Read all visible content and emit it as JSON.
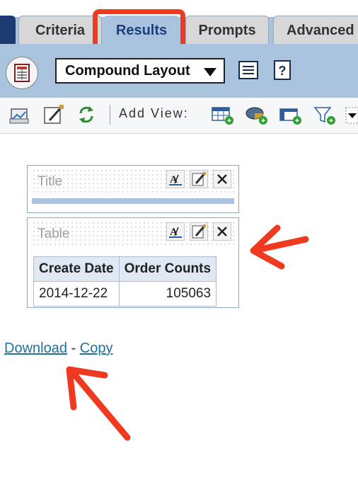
{
  "tabs": [
    {
      "label": "Criteria",
      "active": false
    },
    {
      "label": "Results",
      "active": true
    },
    {
      "label": "Prompts",
      "active": false
    },
    {
      "label": "Advanced",
      "active": false
    }
  ],
  "toolbar": {
    "layout_select": "Compound Layout",
    "add_view_label": "Add View:"
  },
  "title_view": {
    "header_label": "Title"
  },
  "table_view": {
    "header_label": "Table",
    "columns": [
      "Create Date",
      "Order Counts"
    ],
    "rows": [
      {
        "create_date": "2014-12-22",
        "order_counts": "105063"
      }
    ]
  },
  "links": {
    "download": "Download",
    "separator": "-",
    "copy": "Copy"
  },
  "colors": {
    "accent_band": "#a9c3df",
    "annotation": "#f03a1f",
    "link": "#1e6f9e"
  }
}
